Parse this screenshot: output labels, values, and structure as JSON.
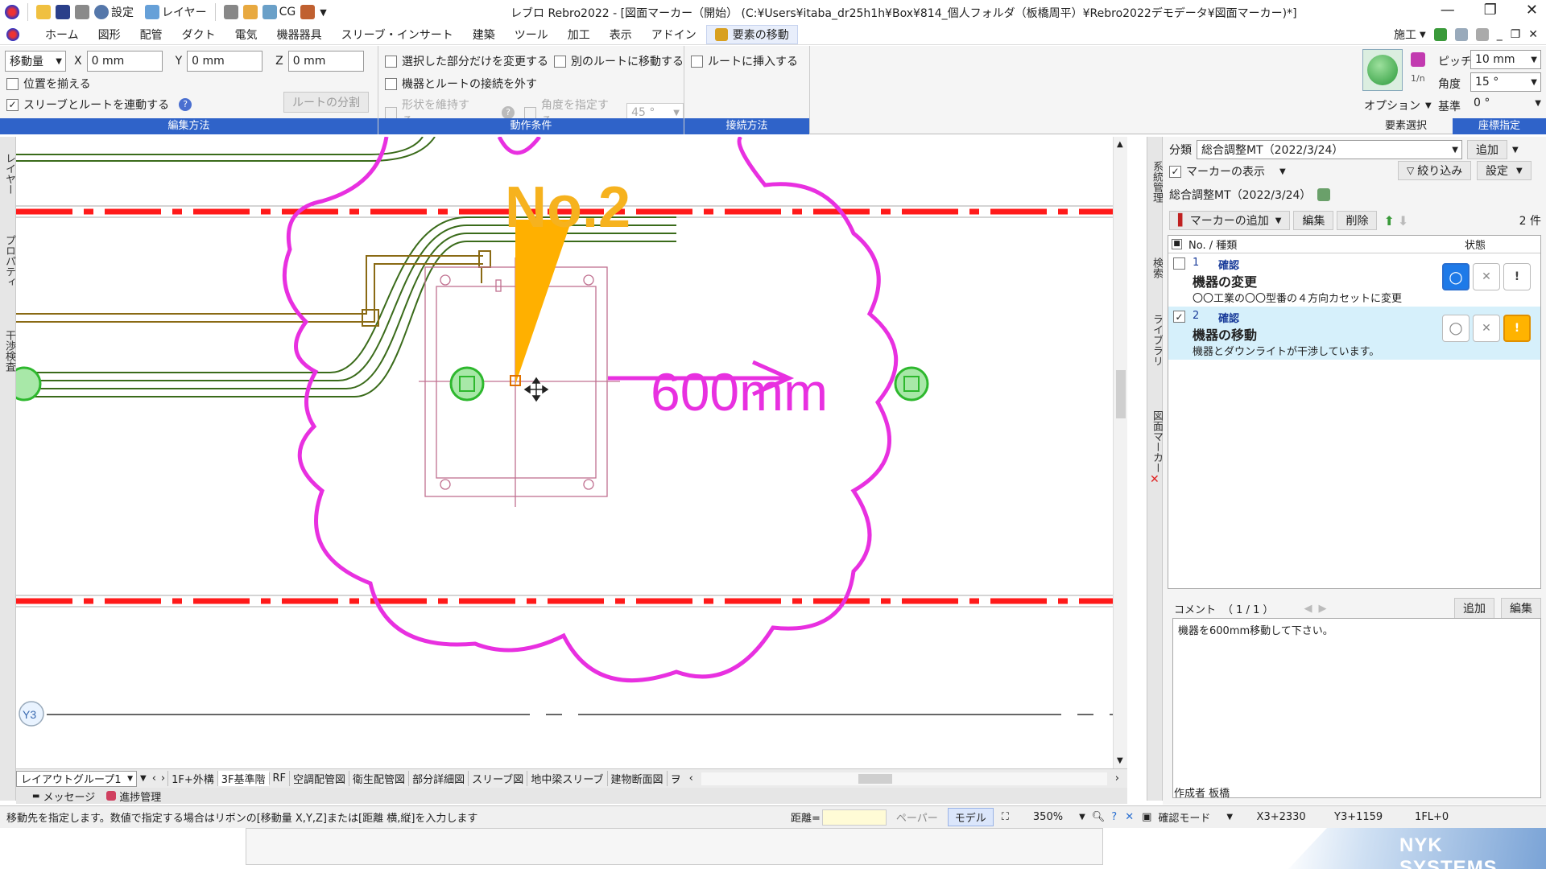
{
  "window": {
    "title": "レブロ Rebro2022 - [図面マーカー（開始） (C:¥Users¥itaba_dr25h1h¥Box¥814_個人フォルダ（板橋周平）¥Rebro2022デモデータ¥図面マーカー)*]",
    "qat": {
      "settings": "設定",
      "layer": "レイヤー",
      "cg": "CG"
    }
  },
  "menu": {
    "items": [
      "ホーム",
      "図形",
      "配管",
      "ダクト",
      "電気",
      "機器器具",
      "スリーブ・インサート",
      "建築",
      "ツール",
      "加工",
      "表示",
      "アドイン"
    ],
    "active": "要素の移動",
    "right_label": "施工"
  },
  "ribbon": {
    "edit": {
      "mode": "移動量",
      "x_label": "X",
      "x_value": "0 mm",
      "y_label": "Y",
      "y_value": "0 mm",
      "z_label": "Z",
      "z_value": "0 mm",
      "align": "位置を揃える",
      "sleeve": "スリーブとルートを連動する",
      "split": "ルートの分割",
      "group": "編集方法"
    },
    "action": {
      "only_selected": "選択した部分だけを変更する",
      "move_other": "別のルートに移動する",
      "disconnect": "機器とルートの接続を外す",
      "keep_shape": "形状を維持する",
      "angle_specify": "角度を指定する",
      "angle_value": "45 °",
      "group": "動作条件"
    },
    "connect": {
      "insert": "ルートに挿入する",
      "group": "接続方法"
    },
    "coords": {
      "pitch_label": "ピッチ",
      "pitch_value": "10 mm",
      "angle_label": "角度",
      "angle_value": "15 °",
      "base_label": "基準",
      "base_value": "0 °",
      "option": "オプション",
      "group_select": "要素選択",
      "group_coord": "座標指定"
    }
  },
  "canvas": {
    "cloud_title": "No.2",
    "dimension": "600mm",
    "grid_label": "Y3",
    "colors": {
      "cloud": "#e830e0",
      "red_line": "#ff1a1a",
      "orange": "#ffb000",
      "pipe_green": "#3a6b1a",
      "pipe_brown": "#8a6a14",
      "fixture": "#5ccf5c"
    }
  },
  "left_tabs": [
    "レイヤー",
    "プロパティ",
    "干渉検査"
  ],
  "right_tabs": [
    "系統管理",
    "検索",
    "ライブラリ",
    "図面マーカー"
  ],
  "sheet_tabs": {
    "group": "レイアウトグループ1",
    "tabs": [
      "1F+外構",
      "3F基準階",
      "RF",
      "空調配管図",
      "衛生配管図",
      "部分詳細図",
      "スリーブ図",
      "地中梁スリーブ",
      "建物断面図",
      "ヲ"
    ]
  },
  "bottom_tabs": [
    "メッセージ",
    "進捗管理"
  ],
  "panel": {
    "category_label": "分類",
    "category_value": "総合調整MT（2022/3/24）",
    "add": "追加",
    "show_marker": "マーカーの表示",
    "filter": "絞り込み",
    "settings": "設定",
    "list_title": "総合調整MT（2022/3/24）",
    "add_marker": "マーカーの追加",
    "edit": "編集",
    "delete": "削除",
    "count": "2 件",
    "col_no": "No. / 種類",
    "col_status": "状態",
    "markers": [
      {
        "no": "1",
        "type": "確認",
        "title": "機器の変更",
        "desc": "〇〇工業の〇〇型番の４方向カセットに変更"
      },
      {
        "no": "2",
        "type": "確認",
        "title": "機器の移動",
        "desc": "機器とダウンライトが干渉しています。"
      }
    ],
    "comment_label": "コメント",
    "comment_count": "（ 1 / 1 ）",
    "comment_add": "追加",
    "comment_edit": "編集",
    "comment_text": "機器を600mm移動して下さい。",
    "author": "作成者 板橋"
  },
  "status": {
    "message": "移動先を指定します。数値で指定する場合はリボンの[移動量 X,Y,Z]または[距離 横,縦]を入力します",
    "distance_label": "距離=",
    "paper": "ペーパー",
    "model": "モデル",
    "zoom": "350%",
    "mode": "確認モード",
    "x_coord": "X3+2330",
    "y_coord": "Y3+1159",
    "floor": "1FL+0"
  },
  "brand": {
    "name": "NYK SYSTEMS"
  }
}
